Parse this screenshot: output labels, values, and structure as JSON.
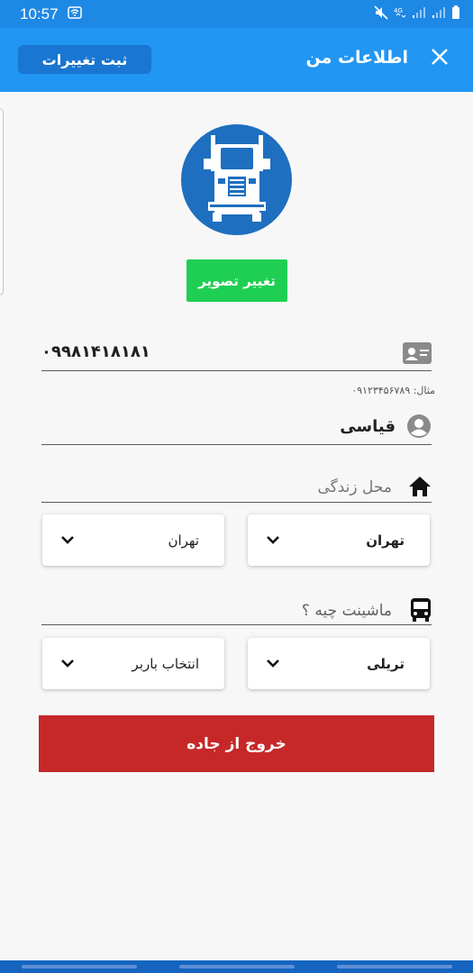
{
  "status_bar": {
    "time": "10:57",
    "icons": [
      "wifi-calling-icon",
      "mute-icon",
      "4g-icon",
      "signal-icon",
      "signal-icon",
      "battery-icon"
    ]
  },
  "app_bar": {
    "title": "اطلاعات من",
    "save_label": "ثبت تغییرات",
    "close_icon": "close-icon"
  },
  "profile": {
    "avatar_icon": "truck-icon",
    "change_photo_label": "تغییر تصویر"
  },
  "form": {
    "phone_value": "۰۹۹۸۱۴۱۸۱۸۱",
    "phone_hint": "مثال: ۰۹۱۲۳۴۵۶۷۸۹",
    "name_value": "قیاسی",
    "residence_label": "محل زندگی",
    "province_value": "تهران",
    "city_value": "تهران",
    "vehicle_label": "ماشینت چیه ؟",
    "vehicle_type_value": "تریلی",
    "carrier_placeholder": "انتخاب باربر",
    "exit_label": "خروج از جاده"
  },
  "colors": {
    "app_bar": "#2196f3",
    "status_bar": "#1e88e5",
    "save_button": "#1976d2",
    "change_photo_button": "#1fcf53",
    "exit_button": "#c62828",
    "avatar_bg": "#1e6fbf"
  }
}
